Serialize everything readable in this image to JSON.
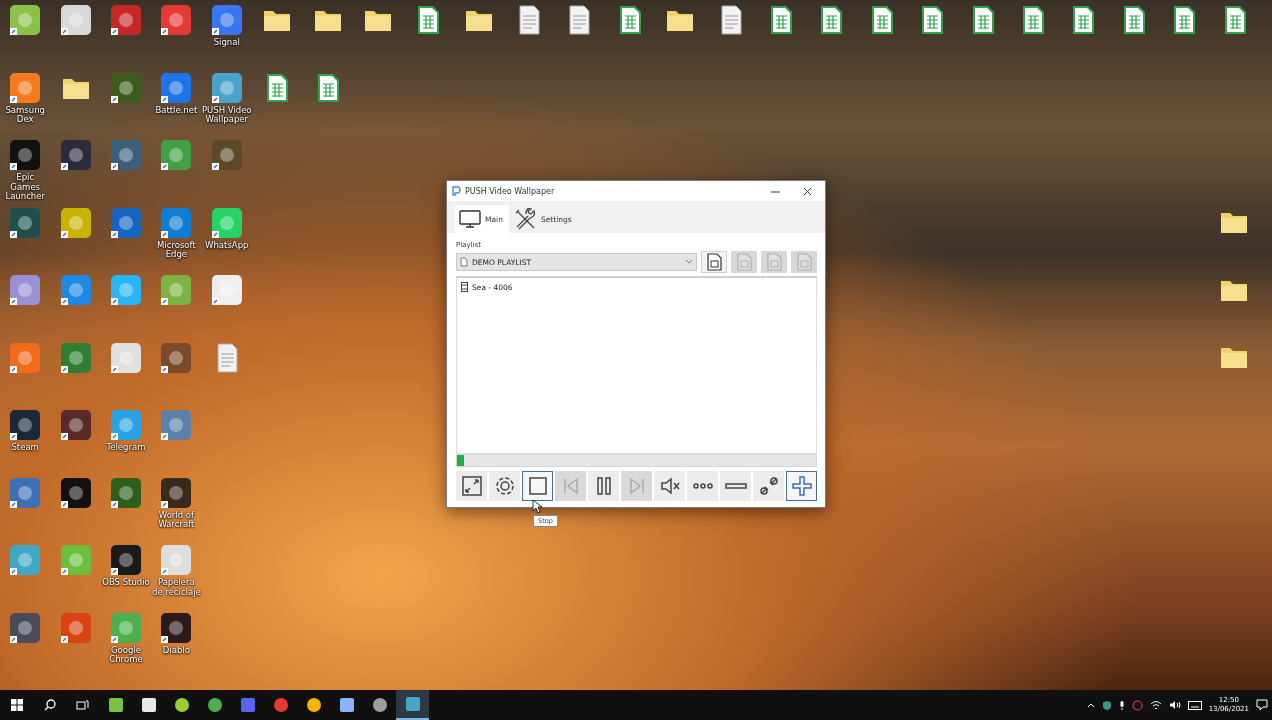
{
  "desktop": {
    "columns": [
      [
        {
          "kind": "app",
          "color": "#8bc34a"
        },
        {
          "kind": "app",
          "color": "#f47b20",
          "label": "Samsung Dex"
        },
        {
          "kind": "app",
          "color": "#111111",
          "label": "Epic Games Launcher"
        },
        {
          "kind": "app",
          "color": "#1f4f4f"
        },
        {
          "kind": "app",
          "color": "#9b8fd6"
        },
        {
          "kind": "app",
          "color": "#f26b1d"
        },
        {
          "kind": "app",
          "color": "#1b2838",
          "label": "Steam"
        },
        {
          "kind": "app",
          "color": "#3d6fb5"
        },
        {
          "kind": "app",
          "color": "#3fa7c8"
        },
        {
          "kind": "app",
          "color": "#4a4a5a"
        }
      ],
      [
        {
          "kind": "app",
          "color": "#d9d9d9"
        },
        {
          "kind": "folder"
        },
        {
          "kind": "app",
          "color": "#2b2b3b"
        },
        {
          "kind": "app",
          "color": "#c8b400"
        },
        {
          "kind": "app",
          "color": "#1e88e5"
        },
        {
          "kind": "app",
          "color": "#2e7d32"
        },
        {
          "kind": "app",
          "color": "#5a2a2a"
        },
        {
          "kind": "app",
          "color": "#111111"
        },
        {
          "kind": "app",
          "color": "#6abf3b"
        },
        {
          "kind": "app",
          "color": "#d84315"
        }
      ],
      [
        {
          "kind": "app",
          "color": "#c62828"
        },
        {
          "kind": "app",
          "color": "#3c5a1c"
        },
        {
          "kind": "app",
          "color": "#3a5f7a"
        },
        {
          "kind": "app",
          "color": "#1565c0"
        },
        {
          "kind": "app",
          "color": "#29b6f6"
        },
        {
          "kind": "app",
          "color": "#e0e0e0"
        },
        {
          "kind": "app",
          "color": "#2aa3e0",
          "label": "Telegram"
        },
        {
          "kind": "app",
          "color": "#2e5d1c"
        },
        {
          "kind": "app",
          "color": "#1a1a1a",
          "label": "OBS Studio"
        },
        {
          "kind": "app",
          "color": "#4caf50",
          "label": "Google Chrome"
        }
      ],
      [
        {
          "kind": "app",
          "color": "#e53935"
        },
        {
          "kind": "app",
          "color": "#1e73e8",
          "label": "Battle.net"
        },
        {
          "kind": "app",
          "color": "#43a047"
        },
        {
          "kind": "app",
          "color": "#0f7dd3",
          "label": "Microsoft Edge"
        },
        {
          "kind": "app",
          "color": "#7cb342"
        },
        {
          "kind": "app",
          "color": "#7a4a2a"
        },
        {
          "kind": "app",
          "color": "#5b7fa8"
        },
        {
          "kind": "app",
          "color": "#3a2a1a",
          "label": "World of Warcraft"
        },
        {
          "kind": "app",
          "color": "#dddddd",
          "label": "Papelera de reciclaje"
        },
        {
          "kind": "app",
          "color": "#2a1a1a",
          "label": "Diablo"
        }
      ],
      [
        {
          "kind": "app",
          "color": "#3a76f0",
          "label": "Signal"
        },
        {
          "kind": "app",
          "color": "#4aa3c8",
          "label": "PUSH Video Wallpaper"
        },
        {
          "kind": "app",
          "color": "#5a4a2a"
        },
        {
          "kind": "app",
          "color": "#25d366",
          "label": "WhatsApp"
        },
        {
          "kind": "app",
          "color": "#eeeeee"
        },
        {
          "kind": "doc"
        }
      ],
      [
        {
          "kind": "folder"
        },
        {
          "kind": "sheet"
        }
      ],
      [
        {
          "kind": "folder"
        },
        {
          "kind": "sheet"
        }
      ],
      [
        {
          "kind": "folder"
        }
      ],
      [
        {
          "kind": "sheet"
        }
      ],
      [
        {
          "kind": "folder"
        }
      ],
      [
        {
          "kind": "doc"
        }
      ],
      [
        {
          "kind": "doc"
        }
      ],
      [
        {
          "kind": "sheet"
        }
      ],
      [
        {
          "kind": "folder"
        }
      ],
      [
        {
          "kind": "doc"
        }
      ],
      [
        {
          "kind": "sheet"
        }
      ],
      [
        {
          "kind": "sheet"
        }
      ],
      [
        {
          "kind": "sheet"
        }
      ],
      [
        {
          "kind": "sheet"
        }
      ],
      [
        {
          "kind": "sheet"
        }
      ],
      [
        {
          "kind": "sheet"
        }
      ],
      [
        {
          "kind": "sheet"
        }
      ],
      [
        {
          "kind": "sheet"
        }
      ],
      [
        {
          "kind": "sheet"
        }
      ],
      [
        {
          "kind": "sheet"
        }
      ]
    ],
    "right_icons": [
      {
        "kind": "folder"
      },
      {
        "kind": "folder"
      },
      {
        "kind": "folder"
      }
    ]
  },
  "window": {
    "title": "PUSH Video Wallpaper",
    "tabs": [
      {
        "label": "Main",
        "kind": "monitor",
        "selected": true
      },
      {
        "label": "Settings",
        "kind": "tools",
        "selected": false
      }
    ],
    "playlist_label": "Playlist",
    "playlist": {
      "value": "DEMO PLAYLIST"
    },
    "playlist_buttons": [
      {
        "kind": "file",
        "disabled": false
      },
      {
        "kind": "file",
        "disabled": true
      },
      {
        "kind": "file",
        "disabled": true
      },
      {
        "kind": "file",
        "disabled": true
      }
    ],
    "items": [
      {
        "label": "Sea - 4006"
      }
    ],
    "progress": {
      "level": 0.02
    },
    "controls": [
      {
        "kind": "fullscreen",
        "disabled": false,
        "highlighted": false
      },
      {
        "kind": "gear",
        "disabled": false,
        "highlighted": false
      },
      {
        "kind": "stop",
        "disabled": false,
        "highlighted": true
      },
      {
        "kind": "prev",
        "disabled": true,
        "highlighted": false
      },
      {
        "kind": "pause",
        "disabled": false,
        "highlighted": false
      },
      {
        "kind": "next",
        "disabled": true,
        "highlighted": false
      },
      {
        "kind": "mute",
        "disabled": false,
        "highlighted": false
      },
      {
        "kind": "dots",
        "disabled": false,
        "highlighted": false
      },
      {
        "kind": "minus",
        "disabled": false,
        "highlighted": false
      },
      {
        "kind": "link",
        "disabled": false,
        "highlighted": false
      },
      {
        "kind": "plus",
        "disabled": false,
        "highlighted": true
      }
    ],
    "tooltip": "Stop"
  },
  "taskbar": {
    "apps": [
      {
        "kind": "square",
        "color": "#7cc142",
        "active": false
      },
      {
        "kind": "square",
        "color": "#e8e8e8",
        "active": false
      },
      {
        "kind": "round",
        "color": "#9acd32",
        "active": false
      },
      {
        "kind": "round",
        "color": "#4caf50",
        "active": false
      },
      {
        "kind": "square",
        "color": "#5865f2",
        "active": false
      },
      {
        "kind": "round",
        "color": "#e53935",
        "active": false
      },
      {
        "kind": "round",
        "color": "#f4b400",
        "active": false
      },
      {
        "kind": "square",
        "color": "#8ab4f8",
        "active": false
      },
      {
        "kind": "round",
        "color": "#9e9e9e",
        "active": false
      },
      {
        "kind": "square",
        "color": "#4aa3c8",
        "active": true
      }
    ],
    "time": "12:50",
    "date": "13/06/2021"
  }
}
